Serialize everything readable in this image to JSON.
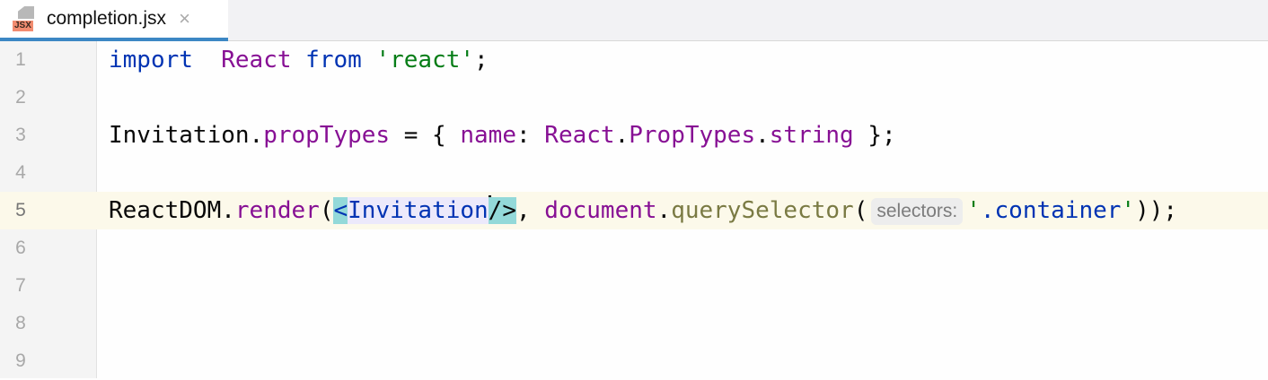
{
  "tab": {
    "filename": "completion.jsx",
    "icon_label": "JSX",
    "close": "×"
  },
  "lines": [
    {
      "num": "1",
      "tokens": [
        [
          "kw",
          "import"
        ],
        [
          "",
          "  "
        ],
        [
          "pu",
          "React"
        ],
        [
          "",
          " "
        ],
        [
          "kw",
          "from"
        ],
        [
          "",
          " "
        ],
        [
          "st",
          "'react'"
        ],
        [
          "",
          ";"
        ]
      ]
    },
    {
      "num": "2",
      "tokens": []
    },
    {
      "num": "3",
      "tokens": [
        [
          "",
          "Invitation."
        ],
        [
          "pu",
          "propTypes"
        ],
        [
          "",
          " = { "
        ],
        [
          "pu",
          "name"
        ],
        [
          "",
          ": "
        ],
        [
          "pu",
          "React"
        ],
        [
          "",
          "."
        ],
        [
          "pu",
          "PropTypes"
        ],
        [
          "",
          "."
        ],
        [
          "pu",
          "string"
        ],
        [
          "",
          " };"
        ]
      ]
    },
    {
      "num": "4",
      "tokens": []
    },
    {
      "num": "5",
      "current": true,
      "tokens": [
        [
          "",
          "ReactDOM."
        ],
        [
          "pu",
          "render"
        ],
        [
          "",
          "("
        ],
        [
          "tg brace",
          "<"
        ],
        [
          "tg tagbg",
          "Invitation"
        ],
        [
          "caret",
          ""
        ],
        [
          "brace",
          "/>"
        ],
        [
          "",
          ", "
        ],
        [
          "pu",
          "document"
        ],
        [
          "",
          "."
        ],
        [
          "mt",
          "querySelector"
        ],
        [
          "",
          "("
        ],
        [
          "hint",
          "selectors:"
        ],
        [
          "st",
          "'"
        ],
        [
          "kw",
          ".container"
        ],
        [
          "st",
          "'"
        ],
        [
          "",
          "));"
        ]
      ]
    },
    {
      "num": "6",
      "tokens": []
    },
    {
      "num": "7",
      "tokens": []
    },
    {
      "num": "8",
      "tokens": []
    },
    {
      "num": "9",
      "tokens": []
    }
  ]
}
